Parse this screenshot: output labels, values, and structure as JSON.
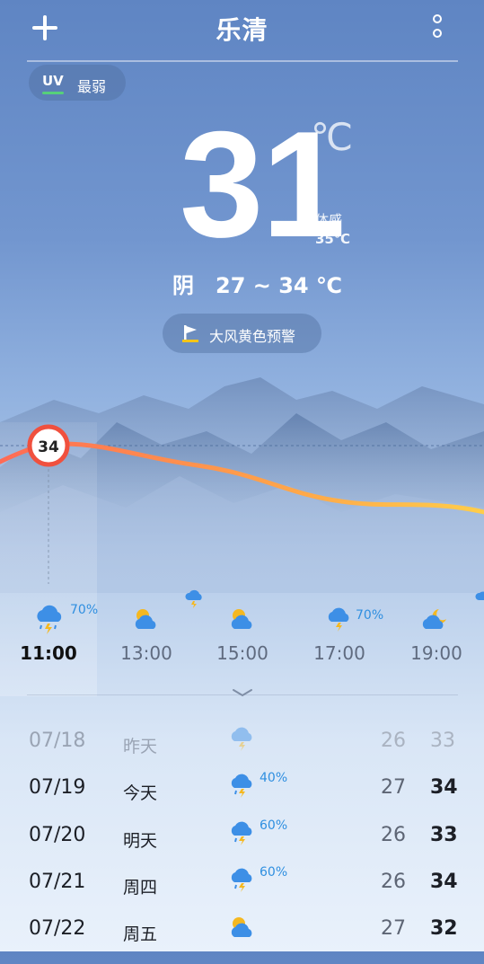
{
  "header": {
    "city": "乐清"
  },
  "uv": {
    "tag": "UV",
    "level": "最弱"
  },
  "current": {
    "temperature": "31",
    "unit": "℃",
    "feels_label": "体感",
    "feels_value": "35℃",
    "condition": "阴",
    "range": "27 ~ 34 ℃"
  },
  "warning": {
    "text": "大风黄色预警"
  },
  "hourly_chart": {
    "highlight_value": "34"
  },
  "hourly": [
    {
      "time": "11:00",
      "icon": "thunder-rain-icon",
      "precip": "70%",
      "current": true
    },
    {
      "time": "13:00",
      "icon": "partly-cloudy-icon",
      "precip": "",
      "current": false
    },
    {
      "time": "15:00",
      "icon": "partly-cloudy-icon",
      "precip": "",
      "current": false
    },
    {
      "time": "17:00",
      "icon": "thunder-rain-icon",
      "precip": "70%",
      "current": false
    },
    {
      "time": "19:00",
      "icon": "partly-cloudy-night-icon",
      "precip": "",
      "current": false
    }
  ],
  "daily": [
    {
      "date": "07/18",
      "week": "昨天",
      "icon": "thunder-rain-icon",
      "precip": "",
      "low": "26",
      "high": "33",
      "past": true
    },
    {
      "date": "07/19",
      "week": "今天",
      "icon": "thunder-rain-icon",
      "precip": "40%",
      "low": "27",
      "high": "34",
      "past": false
    },
    {
      "date": "07/20",
      "week": "明天",
      "icon": "thunder-rain-icon",
      "precip": "60%",
      "low": "26",
      "high": "33",
      "past": false
    },
    {
      "date": "07/21",
      "week": "周四",
      "icon": "thunder-rain-icon",
      "precip": "60%",
      "low": "26",
      "high": "34",
      "past": false
    },
    {
      "date": "07/22",
      "week": "周五",
      "icon": "partly-cloudy-icon",
      "precip": "",
      "low": "27",
      "high": "32",
      "past": false
    }
  ],
  "colors": {
    "accent_blue": "#2f8fe0",
    "uv_green": "#56d07a",
    "curve_start": "#ff6b55",
    "curve_end": "#ffc94a"
  }
}
